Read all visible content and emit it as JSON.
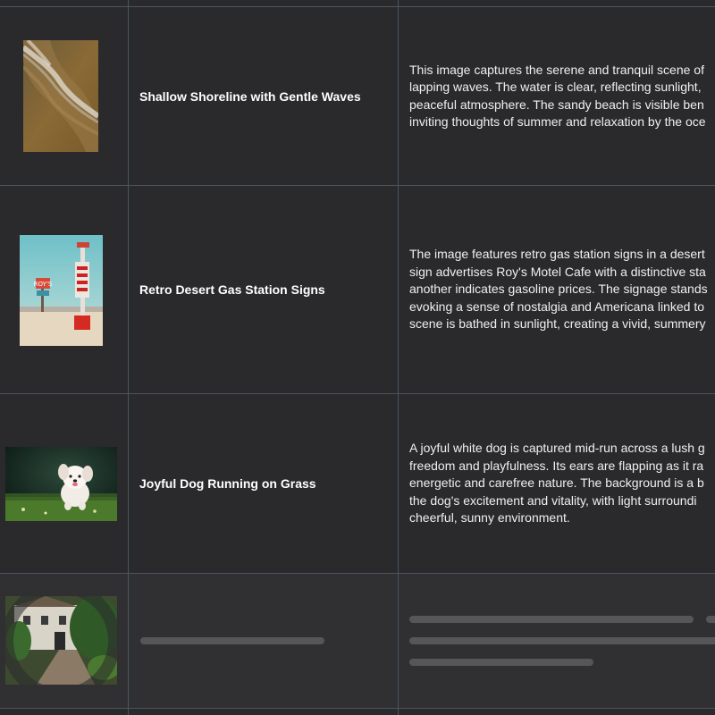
{
  "rows": [
    {
      "title": "Shallow Shoreline with Gentle Waves",
      "description_lines": [
        "This image captures the serene and tranquil scene of",
        "lapping waves. The water is clear, reflecting sunlight,",
        "peaceful atmosphere. The sandy beach is visible ben",
        "inviting thoughts of summer and relaxation by the oce"
      ],
      "thumbnail_icon": "beach-waves-photo"
    },
    {
      "title": "Retro Desert Gas Station Signs",
      "description_lines": [
        "The image features retro gas station signs in a desert",
        "sign advertises Roy's Motel Cafe with a distinctive sta",
        "another indicates gasoline prices. The signage stands",
        "evoking a sense of nostalgia and Americana linked to",
        "scene is bathed in sunlight, creating a vivid, summery"
      ],
      "thumbnail_icon": "gas-station-photo"
    },
    {
      "title": "Joyful Dog Running on Grass",
      "description_lines": [
        "A joyful white dog is captured mid-run across a lush g",
        "freedom and playfulness. Its ears are flapping as it ra",
        "energetic and carefree nature. The background is a b",
        "the dog's excitement and vitality, with light surroundi",
        "cheerful, sunny environment."
      ],
      "thumbnail_icon": "dog-photo"
    }
  ],
  "loading_row": {
    "thumbnail_icon": "house-garden-photo"
  },
  "colors": {
    "background": "#2a292b",
    "grid_line": "#4a5560",
    "skeleton": "#565558"
  }
}
